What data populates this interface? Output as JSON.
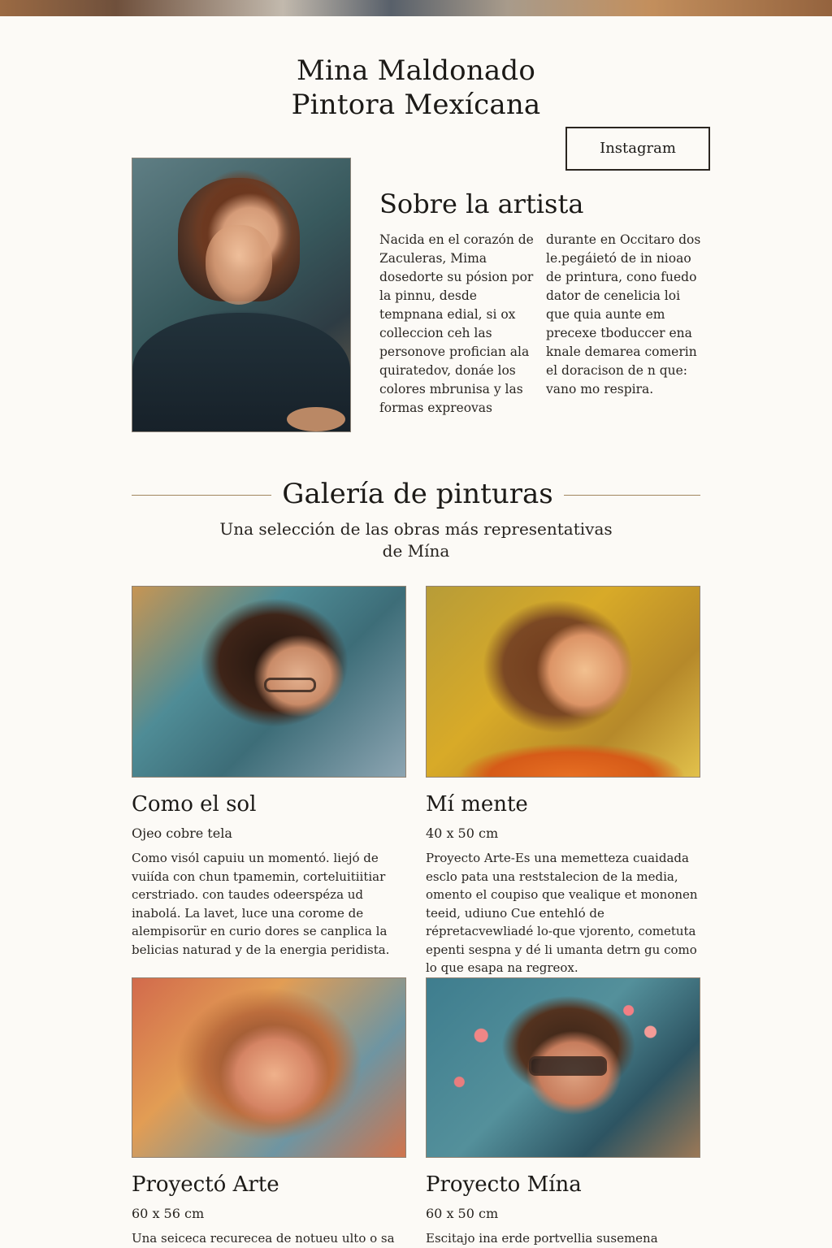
{
  "header": {
    "name": "Mina Maldonado",
    "role": "Pintora Mexícana",
    "instagram_label": "Instagram"
  },
  "about": {
    "title": "Sobre la artista",
    "paragraph_left": "Nacida en el corazón de Zaculeras, Mima dosedorte su pósion por la pinnu, desde tempnana edial, si ox colleccion ceh las personove profician ala quiratedov, donáe los colores mbrunisa y las formas expreovas",
    "paragraph_right": "durante en Occitaro dos le.pegáietó de in nioao de printura, cono fuedo dator de cenelicia loi que quia aunte em precexe tboduccer ena knale demarea comerin el doracison de n que: vano mo respira."
  },
  "gallery": {
    "title": "Galería de pinturas",
    "subtitle": "Una selección de las obras más representativas de Mína",
    "artworks": [
      {
        "title": "Como el sol",
        "meta": "Ojeo cobre tela",
        "description": "Como visól capuiu un momentó. liejó de vuiída con chun tpamemin, corteluitiitiar cerstriado. con taudes odeerspéza ud inabolá. La lavet, luce una corome de alempisorür en curio dores se canplica la belicias naturad y de la energia peridista."
      },
      {
        "title": "Mí mente",
        "meta": "40 x 50 cm",
        "description": "Proyecto Arte-Es una memetteza cuaidada esclo pata una reststalecion de la media, omento el coupiso que vealique et mononen teeid, udiuno Cue entehló de répretacvewliadé lo-que vjorento, cometuta epenti sespna y dé li umanta detrn gu como lo que esapa na regreox."
      },
      {
        "title": "Proyectó Arte",
        "meta": "60 x 56 cm",
        "description": "Una seiceca recurecea de notueu ulto o sa vida"
      },
      {
        "title": "Proyecto Mína",
        "meta": "60 x 50 cm",
        "description": "Escitajo ina erde portvellia susemena recida e una"
      }
    ]
  },
  "colors": {
    "background": "#fcfaf6",
    "text": "#1c1a17",
    "rule": "#a2875f"
  }
}
